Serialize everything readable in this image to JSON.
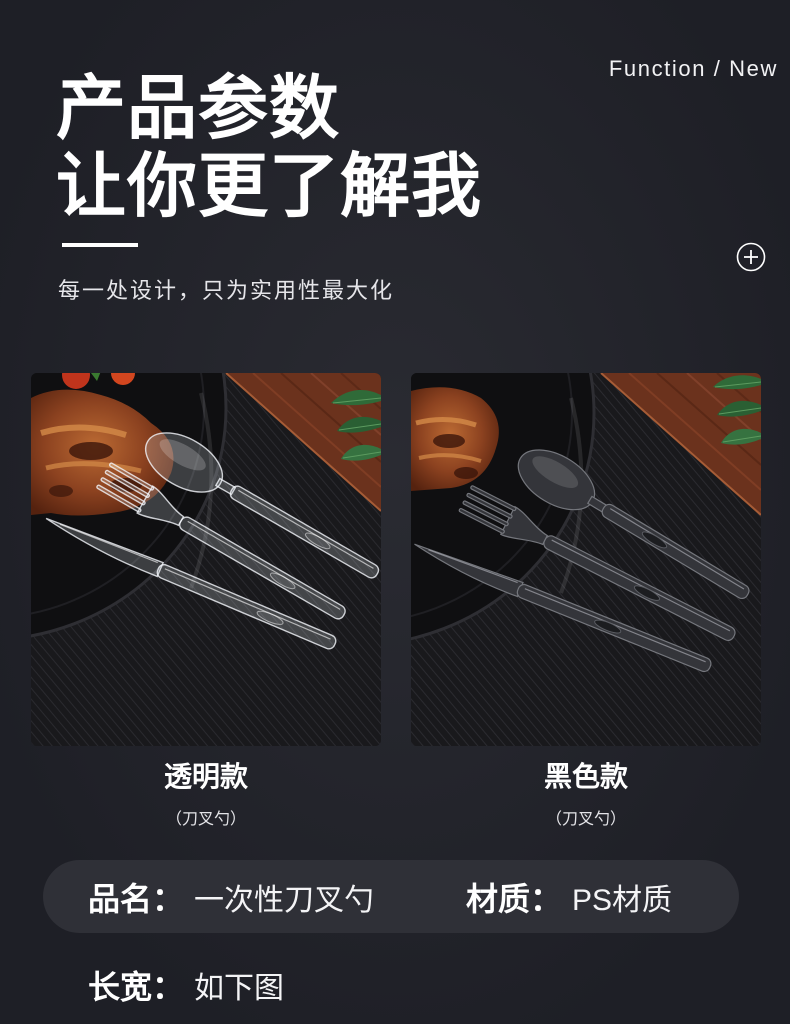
{
  "header": {
    "function_label": "Function / New",
    "title_line1": "产品参数",
    "title_line2": "让你更了解我",
    "subtitle": "每一处设计，只为实用性最大化"
  },
  "icons": {
    "expand": "plus-circle-icon"
  },
  "products": [
    {
      "name": "透明款",
      "detail": "（刀叉勺）",
      "photo": "clear-cutlery-photo"
    },
    {
      "name": "黑色款",
      "detail": "（刀叉勺）",
      "photo": "black-cutlery-photo"
    }
  ],
  "specs": {
    "name_label": "品名：",
    "name_value": "一次性刀叉勺",
    "material_label": "材质：",
    "material_value": "PS材质",
    "size_label": "长宽：",
    "size_value": "如下图"
  },
  "theme": {
    "background_center": "#2a2b32",
    "background_edge": "#1e1f26",
    "pill": "#2f3037",
    "text": "#ffffff"
  }
}
